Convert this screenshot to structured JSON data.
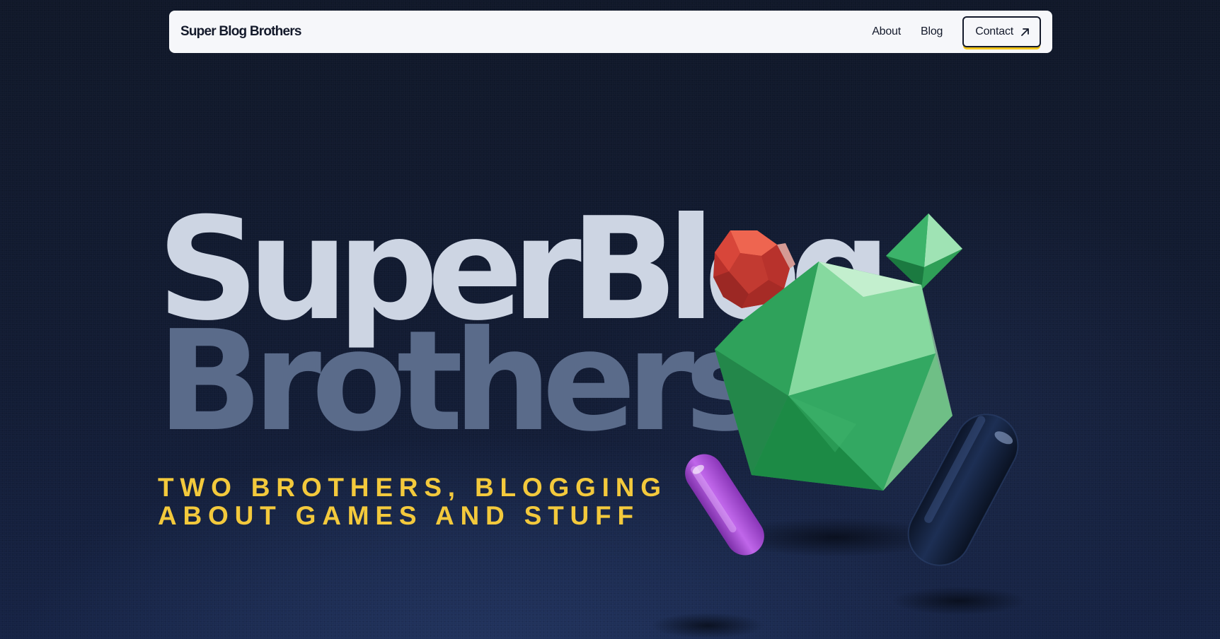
{
  "nav": {
    "brand": "Super Blog Brothers",
    "links": [
      {
        "label": "About"
      },
      {
        "label": "Blog"
      }
    ],
    "contact_label": "Contact",
    "contact_icon": "arrow-up-right-icon"
  },
  "hero": {
    "title_line1": "SuperBlog",
    "title_line2": "Brothers",
    "tagline_line1": "TWO BROTHERS, BLOGGING",
    "tagline_line2": "ABOUT GAMES AND STUFF"
  },
  "colors": {
    "background": "#111a30",
    "nav_background": "#f6f7fa",
    "title_light": "#cdd5e3",
    "title_muted": "#5a6b8a",
    "tagline": "#f3c93c",
    "contact_underline": "#f1c61a",
    "shape_green": "#2fa85c",
    "shape_red": "#d9473a",
    "shape_purple": "#a24ccf",
    "shape_navy": "#12203b"
  },
  "decor": {
    "shapes": [
      "icosahedron",
      "dodecahedron",
      "octahedron",
      "purple-capsule",
      "navy-capsule"
    ]
  }
}
